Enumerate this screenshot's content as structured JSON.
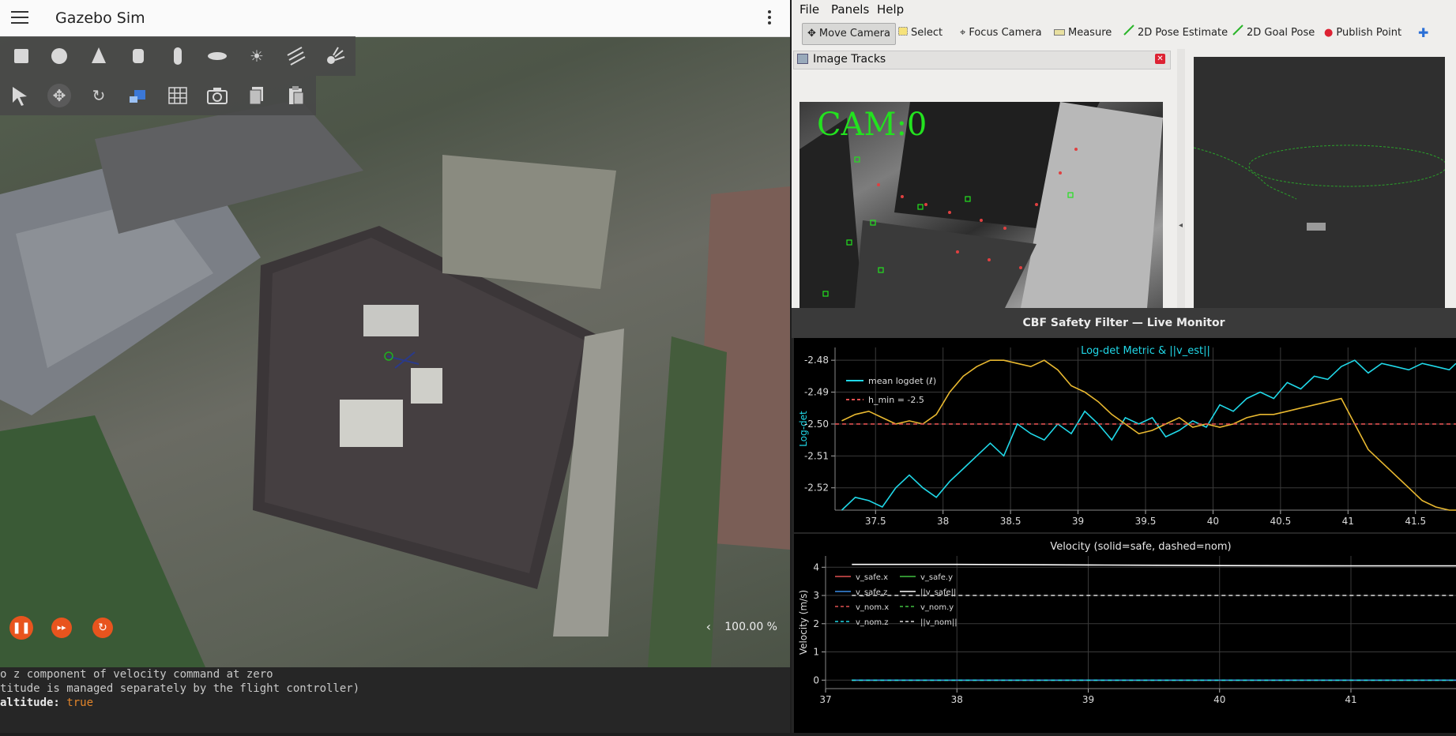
{
  "gazebo": {
    "title": "Gazebo Sim",
    "shape_tools": [
      "box-icon",
      "sphere-icon",
      "cone-icon",
      "cylinder-icon",
      "capsule-icon",
      "ellipsoid-icon",
      "sun-icon",
      "directional-light-icon",
      "spot-light-icon"
    ],
    "transform_tools": [
      "select-arrow-icon",
      "translate-icon",
      "rotate-icon",
      "insert-model-icon",
      "grid-icon",
      "camera-icon",
      "copy-icon",
      "paste-icon"
    ],
    "zoom": "100.00 %",
    "colors": {
      "play_button": "#e8541e",
      "header": "#fafafa"
    }
  },
  "terminal": {
    "lines": [
      {
        "text": "o z component of velocity command at zero"
      },
      {
        "text": "titude is managed separately by the flight controller)"
      },
      {
        "key": "altitude:",
        "value": "true"
      }
    ]
  },
  "rviz": {
    "menu": [
      "File",
      "Panels",
      "Help"
    ],
    "toolbar": [
      {
        "label": "Move Camera",
        "icon": "move-camera-icon",
        "active": true
      },
      {
        "label": "Select",
        "icon": "select-rect-icon"
      },
      {
        "label": "Focus Camera",
        "icon": "focus-camera-icon"
      },
      {
        "label": "Measure",
        "icon": "ruler-icon"
      },
      {
        "label": "2D Pose Estimate",
        "icon": "pose-estimate-icon"
      },
      {
        "label": "2D Goal Pose",
        "icon": "goal-pose-icon"
      },
      {
        "label": "Publish Point",
        "icon": "map-pin-icon"
      }
    ],
    "image_panel": {
      "title": "Image Tracks",
      "overlay_text": "CAM:0"
    }
  },
  "cbf": {
    "window_title": "CBF Safety Filter — Live Monitor",
    "colors": {
      "cyan": "#20d8e8",
      "orange": "#e8b830",
      "threshold": "#e05050"
    },
    "chart_data": [
      {
        "type": "line",
        "title": "Log-det Metric & ||v_est||",
        "ylabel": "Log-det",
        "xlim": [
          37.2,
          41.8
        ],
        "ylim": [
          -2.527,
          -2.476
        ],
        "x_ticks": [
          "37.5",
          "38",
          "38.5",
          "39",
          "39.5",
          "40",
          "40.5",
          "41",
          "41.5"
        ],
        "y_ticks": [
          "-2.48",
          "-2.49",
          "-2.50",
          "-2.51",
          "-2.52"
        ],
        "series": [
          {
            "name": "mean logdet (ℓ)",
            "color": "#20d8e8",
            "x": [
              37.25,
              37.35,
              37.45,
              37.55,
              37.65,
              37.75,
              37.85,
              37.95,
              38.05,
              38.15,
              38.25,
              38.35,
              38.45,
              38.55,
              38.65,
              38.75,
              38.85,
              38.95,
              39.05,
              39.15,
              39.25,
              39.35,
              39.45,
              39.55,
              39.65,
              39.75,
              39.85,
              39.95,
              40.05,
              40.15,
              40.25,
              40.35,
              40.45,
              40.55,
              40.65,
              40.75,
              40.85,
              40.95,
              41.05,
              41.15,
              41.25,
              41.35,
              41.45,
              41.55,
              41.65,
              41.75,
              41.8
            ],
            "y": [
              -2.527,
              -2.523,
              -2.524,
              -2.526,
              -2.52,
              -2.516,
              -2.52,
              -2.523,
              -2.518,
              -2.514,
              -2.51,
              -2.506,
              -2.51,
              -2.5,
              -2.503,
              -2.505,
              -2.5,
              -2.503,
              -2.496,
              -2.5,
              -2.505,
              -2.498,
              -2.5,
              -2.498,
              -2.504,
              -2.502,
              -2.499,
              -2.501,
              -2.494,
              -2.496,
              -2.492,
              -2.49,
              -2.492,
              -2.487,
              -2.489,
              -2.485,
              -2.486,
              -2.482,
              -2.48,
              -2.484,
              -2.481,
              -2.482,
              -2.483,
              -2.481,
              -2.482,
              -2.483,
              -2.481
            ]
          },
          {
            "name": "",
            "color": "#e8b830",
            "x": [
              37.25,
              37.35,
              37.45,
              37.55,
              37.65,
              37.75,
              37.85,
              37.95,
              38.05,
              38.15,
              38.25,
              38.35,
              38.45,
              38.55,
              38.65,
              38.75,
              38.85,
              38.95,
              39.05,
              39.15,
              39.25,
              39.35,
              39.45,
              39.55,
              39.65,
              39.75,
              39.85,
              39.95,
              40.05,
              40.15,
              40.25,
              40.35,
              40.45,
              40.55,
              40.65,
              40.75,
              40.85,
              40.95,
              41.05,
              41.15,
              41.25,
              41.35,
              41.45,
              41.55,
              41.65,
              41.75,
              41.8
            ],
            "y": [
              -2.499,
              -2.497,
              -2.496,
              -2.498,
              -2.5,
              -2.499,
              -2.5,
              -2.497,
              -2.49,
              -2.485,
              -2.482,
              -2.48,
              -2.48,
              -2.481,
              -2.482,
              -2.48,
              -2.483,
              -2.488,
              -2.49,
              -2.493,
              -2.497,
              -2.5,
              -2.503,
              -2.502,
              -2.5,
              -2.498,
              -2.501,
              -2.5,
              -2.501,
              -2.5,
              -2.498,
              -2.497,
              -2.497,
              -2.496,
              -2.495,
              -2.494,
              -2.493,
              -2.492,
              -2.5,
              -2.508,
              -2.512,
              -2.516,
              -2.52,
              -2.524,
              -2.526,
              -2.527,
              -2.527
            ]
          },
          {
            "name": "h_min = -2.5",
            "color": "#e05050",
            "dashed": true,
            "x": [
              37.2,
              41.8
            ],
            "y": [
              -2.5,
              -2.5
            ]
          }
        ],
        "legend": "top-left",
        "grid": true
      },
      {
        "type": "line",
        "title": "Velocity (solid=safe, dashed=nom)",
        "ylabel": "Velocity (m/s)",
        "xlim": [
          37,
          41.8
        ],
        "ylim": [
          -0.3,
          4.4
        ],
        "x_ticks": [
          "37",
          "38",
          "39",
          "40",
          "41"
        ],
        "y_ticks": [
          "4",
          "3",
          "2",
          "1",
          "0"
        ],
        "series": [
          {
            "name": "v_safe.x",
            "color": "#e05050",
            "x": [
              37.2,
              41.8
            ],
            "y": [
              0,
              0
            ]
          },
          {
            "name": "v_safe.y",
            "color": "#40c040",
            "x": [
              37.2,
              41.8
            ],
            "y": [
              0,
              0
            ]
          },
          {
            "name": "v_safe.z",
            "color": "#3a8ee8",
            "x": [
              37.2,
              41.8
            ],
            "y": [
              0,
              0
            ]
          },
          {
            "name": "||v_safe||",
            "color": "#ffffff",
            "x": [
              37.2,
              38.0,
              39.0,
              40.0,
              41.0,
              41.8
            ],
            "y": [
              4.1,
              4.1,
              4.08,
              4.06,
              4.05,
              4.05
            ]
          },
          {
            "name": "v_nom.x",
            "color": "#e05050",
            "dashed": true,
            "x": [
              37.2,
              41.8
            ],
            "y": [
              0,
              0
            ]
          },
          {
            "name": "v_nom.y",
            "color": "#40c040",
            "dashed": true,
            "x": [
              37.2,
              41.8
            ],
            "y": [
              0,
              0
            ]
          },
          {
            "name": "v_nom.z",
            "color": "#20d8e8",
            "dashed": true,
            "x": [
              37.2,
              41.8
            ],
            "y": [
              0,
              0
            ]
          },
          {
            "name": "||v_nom||",
            "color": "#dddddd",
            "dashed": true,
            "x": [
              37.2,
              41.8
            ],
            "y": [
              3.0,
              3.0
            ]
          }
        ],
        "legend": "top-left",
        "grid": true
      }
    ]
  }
}
